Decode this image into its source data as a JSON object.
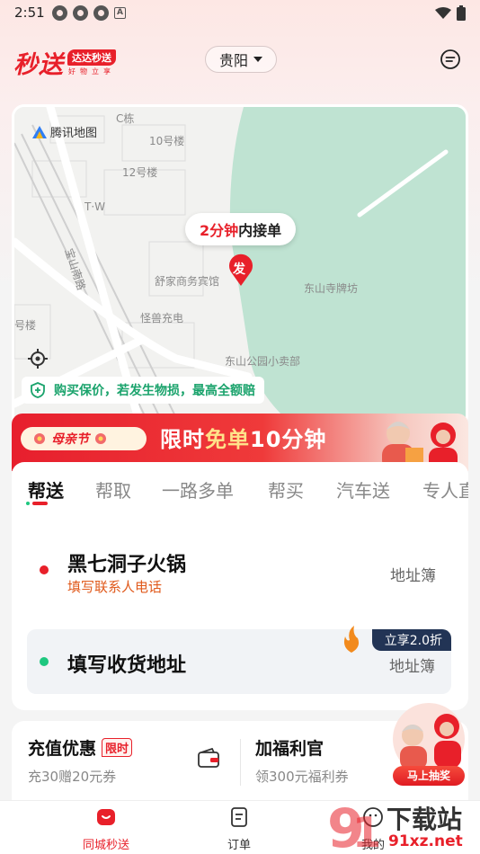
{
  "status_bar": {
    "time": "2:51"
  },
  "header": {
    "logo": "秒送",
    "logo_tag": "达达秒送",
    "logo_slogan": "好物立享",
    "city": "贵阳"
  },
  "map": {
    "attribution": "腾讯地图",
    "labels": [
      "C栋",
      "10号楼",
      "12号楼",
      "T·W",
      "舒家商务宾馆",
      "怪兽充电",
      "东山寺牌坊",
      "东山公园小卖部",
      "号楼",
      "宝山南路"
    ],
    "bubble_time": "2分钟",
    "bubble_text": "内接单",
    "pin_label": "发",
    "guarantee": "购买保价，若发生物损，最高全额赔"
  },
  "banner": {
    "badge": "母亲节",
    "title_pre": "限时",
    "title_hl": "免单",
    "title_post": "10分钟"
  },
  "tabs": [
    "帮送",
    "帮取",
    "一路多单",
    "帮买",
    "汽车送",
    "专人直送"
  ],
  "sender": {
    "name": "黑七洞子火锅",
    "sub": "填写联系人电话",
    "address_book": "地址簿"
  },
  "receiver": {
    "placeholder": "填写收货地址",
    "address_book": "地址簿",
    "discount": "立享2.0折"
  },
  "promo": {
    "recharge_title": "充值优惠",
    "recharge_tag": "限时",
    "recharge_sub": "充30赠20元券",
    "welfare_title": "加福利官",
    "welfare_sub": "领300元福利券",
    "lottery_btn": "马上抽奖"
  },
  "nav": [
    {
      "label": "同城秒送",
      "icon": "home-icon",
      "active": true
    },
    {
      "label": "订单",
      "icon": "order-icon",
      "active": false
    },
    {
      "label": "我的",
      "icon": "profile-icon",
      "active": false
    }
  ],
  "watermark": {
    "main": "下载站",
    "site": "91xz.net"
  },
  "colors": {
    "brand": "#e8202a",
    "green": "#1ec77f",
    "navy": "#223455"
  }
}
